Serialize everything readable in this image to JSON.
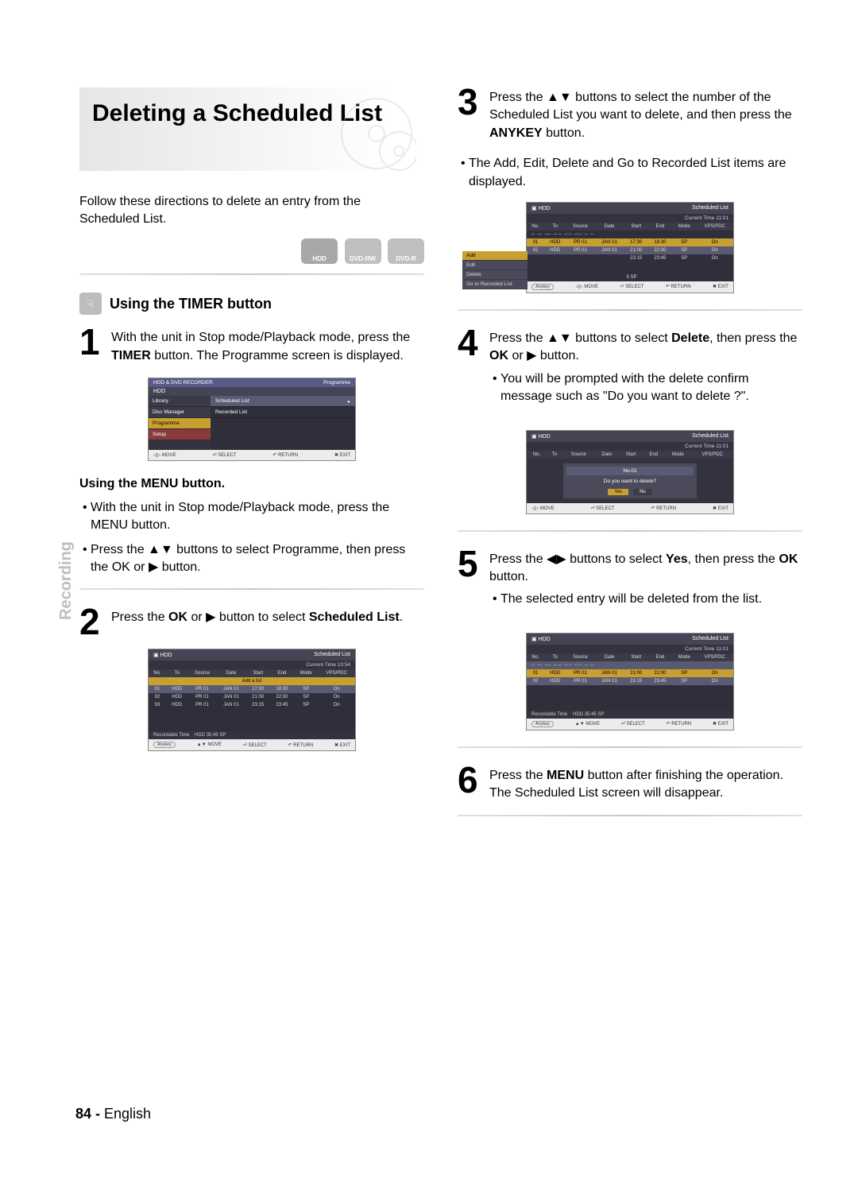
{
  "page": {
    "number": "84",
    "lang": "English",
    "side_label": "Recording"
  },
  "title": "Deleting a Scheduled List",
  "intro": "Follow these directions to delete an entry from the Scheduled List.",
  "media": {
    "hdd": "HDD",
    "dvdrw": "DVD-RW",
    "dvdr": "DVD-R"
  },
  "subhead": "Using the TIMER button",
  "step1": {
    "num": "1",
    "text_a": "With the unit in Stop mode/Playback mode, press the ",
    "timer": "TIMER",
    "text_b": " button. The Programme screen is displayed."
  },
  "menu_sub": "Using the MENU button.",
  "menu_b1_a": "With the unit in Stop mode/Playback mode, press the ",
  "menu_b1_b": "MENU",
  "menu_b1_c": " button.",
  "menu_b2_a": "Press the ",
  "menu_b2_b": " buttons to select ",
  "menu_b2_prog": "Programme",
  "menu_b2_c": ", then press the ",
  "menu_b2_ok": "OK",
  "menu_b2_d": " or ",
  "menu_b2_e": " button.",
  "step2": {
    "num": "2",
    "a": "Press the ",
    "ok": "OK",
    "b": " or ",
    "c": " button to select ",
    "sl": "Scheduled List",
    "d": "."
  },
  "step3": {
    "num": "3",
    "a": "Press the ",
    "b": " buttons to select the number of the Scheduled List you want to delete, and then press the ",
    "anykey": "ANYKEY",
    "c": " button.",
    "bullet_a": "The ",
    "bullet_add": "Add",
    "bullet_edit": "Edit",
    "bullet_del": "Delete",
    "bullet_and": " and ",
    "bullet_goto": "Go to Recorded List",
    "bullet_b": " items are displayed."
  },
  "step4": {
    "num": "4",
    "a": "Press the ",
    "b": " buttons to select ",
    "del": "Delete",
    "c": ", then press the ",
    "ok": "OK",
    "d": " or ",
    "e": " button.",
    "bullet": "You will be prompted with the delete confirm message such as \"Do you want to delete ?\"."
  },
  "step5": {
    "num": "5",
    "a": "Press the ",
    "b": " buttons to select ",
    "yes": "Yes",
    "c": ", then press the ",
    "ok": "OK",
    "d": " button.",
    "bullet": "The selected entry will be deleted from the list."
  },
  "step6": {
    "num": "6",
    "a": "Press the ",
    "menu": "MENU",
    "b": " button after finishing the operation. The Scheduled List screen will disappear."
  },
  "osd_common": {
    "hdd": "HDD",
    "scheduled_list": "Scheduled List",
    "recorder": "HDD & DVD RECORDER",
    "programme": "Programme",
    "library": "Library",
    "disc_manager": "Disc Manager",
    "setup": "Setup",
    "recorded_list": "Recorded List",
    "move": "MOVE",
    "select": "SELECT",
    "return": "RETURN",
    "exit": "EXIT",
    "anykey": "Anykey",
    "recordable": "Recordable Time",
    "rec_value": "HDD  35:45 SP",
    "current_time_a": "Current Time 10:54",
    "current_time_b": "Current Time 11:01",
    "headers": {
      "no": "No.",
      "to": "To",
      "source": "Source",
      "date": "Date",
      "start": "Start",
      "end": "End",
      "mode": "Mode",
      "vps": "VPS/PDC"
    },
    "placeholder": "-- --- ---- -- -- --:-- --:-- -- --",
    "add_list": "Add a list"
  },
  "osd2_rows": [
    {
      "no": "01",
      "to": "HDD",
      "src": "PR 01",
      "date": "JAN 01",
      "start": "17:30",
      "end": "18:30",
      "mode": "SP",
      "vps": "On"
    },
    {
      "no": "02",
      "to": "HDD",
      "src": "PR 01",
      "date": "JAN 01",
      "start": "21:00",
      "end": "22:00",
      "mode": "SP",
      "vps": "On"
    },
    {
      "no": "03",
      "to": "HDD",
      "src": "PR 01",
      "date": "JAN 01",
      "start": "23:15",
      "end": "23:45",
      "mode": "SP",
      "vps": "On"
    }
  ],
  "osd3_rows": [
    {
      "no": "01",
      "to": "HDD",
      "src": "PR 01",
      "date": "JAN 01",
      "start": "17:30",
      "end": "18:30",
      "mode": "SP",
      "vps": "On"
    },
    {
      "no": "02",
      "to": "HDD",
      "src": "PR 01",
      "date": "JAN 01",
      "start": "21:00",
      "end": "22:00",
      "mode": "SP",
      "vps": "On"
    },
    {
      "no": "",
      "to": "",
      "src": "",
      "date": "",
      "start": "23:15",
      "end": "23:45",
      "mode": "SP",
      "vps": "On"
    }
  ],
  "context_menu": {
    "add": "Add",
    "edit": "Edit",
    "delete": "Delete",
    "goto": "Go to Recorded List",
    "tail": "5 SP"
  },
  "osd4": {
    "no01": "No.01",
    "question": "Do you want to delete?",
    "yes": "Yes",
    "no": "No"
  },
  "osd5_rows": [
    {
      "no": "01",
      "to": "HDD",
      "src": "PR 01",
      "date": "JAN 01",
      "start": "21:00",
      "end": "22:00",
      "mode": "SP",
      "vps": "On"
    },
    {
      "no": "02",
      "to": "HDD",
      "src": "PR 01",
      "date": "JAN 01",
      "start": "23:15",
      "end": "23:45",
      "mode": "SP",
      "vps": "On"
    }
  ]
}
